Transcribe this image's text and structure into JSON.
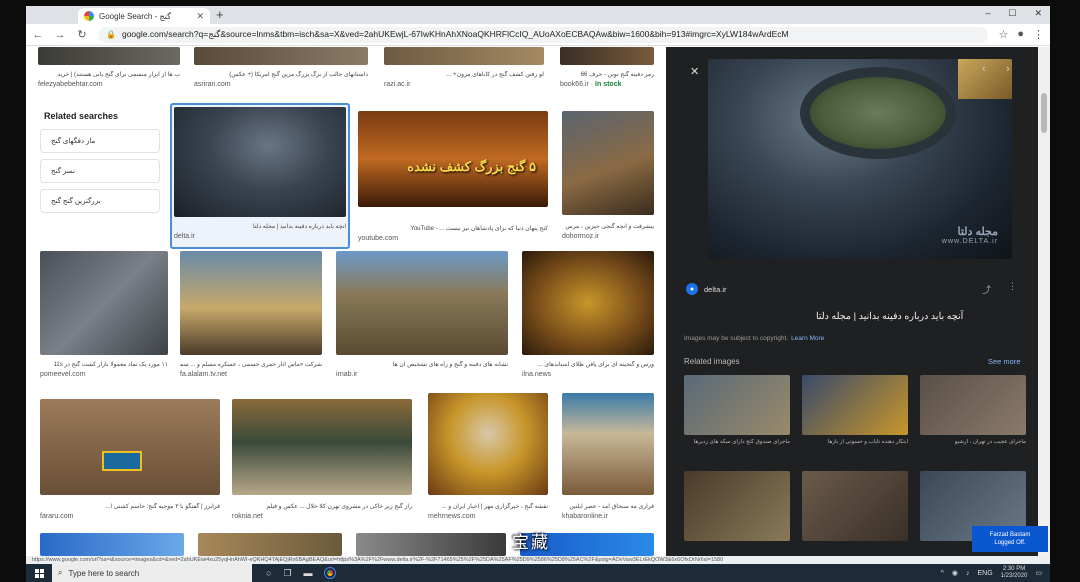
{
  "browser": {
    "tab_title": "Google Search - گنج",
    "new_tab": "+",
    "window_controls": [
      "–",
      "☐",
      "✕"
    ],
    "url": "google.com/search?q=گنج&source=lnms&tbm=isch&sa=X&ved=2ahUKEwjL-67IwKHnAhXNoaQKHRFlCcIQ_AUoAXoECBAQAw&biw=1600&bih=913#imgrc=XyLW184wArdEcM"
  },
  "top_row": [
    {
      "caption": "ب ها از ابزار منسمی برای گنج یابی هستند) | خرید",
      "site": "felezyabebehtar.com"
    },
    {
      "caption": "داستانهای جالب از برگ یزرگ مزین گنج آمریکا (+ عکس)",
      "site": "asriran.com"
    },
    {
      "caption": "لو رفتن کشف گنج در کاناهای مزون+ ...",
      "site": "razi.ac.ir"
    },
    {
      "caption": "رمز دفینه گنج نوین - حرف 66",
      "site": "book66.ir",
      "instock": "In stock"
    }
  ],
  "related_searches": {
    "title": "Related searches",
    "items": [
      "ماز دفگهای گنج",
      "نسر گنج",
      "بزرگترین گنج گنج"
    ]
  },
  "row2": [
    {
      "caption": "آنچه باید درباره دفینه بدانید | مجله دلتا",
      "site": "delta.ir"
    },
    {
      "caption": "کنج پنهان دنیا که برای پادشاهان نیز نیست ... - YouTube",
      "site": "youtube.com",
      "banner": "۵ گنج بزرگ کشف نشده"
    },
    {
      "caption": "پیشرفت و آنچه گنجی حیزین ، مرس",
      "site": "dohormoz.ir"
    }
  ],
  "row3": [
    {
      "caption": "۱۱ مورد یک نماد معمولا بازار کشت گنج در 11s",
      "site": "pomeevel.com"
    },
    {
      "caption": "شرکت «ماس آثار حمری جسمی ، عسكره مسلم و ... سمتان گنجشه",
      "site": "fa.alalam.tv.net"
    },
    {
      "caption": "نشانه های دفینه و گنج و راه های تشخیص آن ها",
      "site": "irnab.ir"
    },
    {
      "caption": "ورس و گنجینه ای برای پافن طلای استاندهای ...",
      "site": "ilna.news"
    }
  ],
  "row4": [
    {
      "caption": "فرابرز | گفتگو با ۳ موجبه گنج: حاسم کشتی آ...",
      "site": "fararu.com"
    },
    {
      "caption": "راز گنج زیر خاکی در مشروی تهرن کلا خلال ... عکس و فیلم",
      "site": "roknia.net"
    },
    {
      "caption": "نقشه گنج ، خبرگزاری مهر | اخبار ایران و ...",
      "site": "mehrnews.com"
    },
    {
      "caption": "قراری مه سنجاق آمد - عصر ایلتین",
      "site": "khabaronline.ir"
    }
  ],
  "preview": {
    "close": "✕",
    "watermark_fa": "مجله دلتا",
    "watermark_en": "www.DELTA.ir",
    "source": "delta.ir",
    "title": "آنچه باید درباره دفینه بدانید | مجله دلتا",
    "copyright": "Images may be subject to copyright.",
    "learn_more": "Learn More",
    "related_title": "Related images",
    "see_more": "See more",
    "related_captions": [
      "ماجرای صندوق گنج دارای سکه های زدیرها",
      "ابتکار دهنده تایاب و حسوتی از بازها",
      "ماجرای عجیب در تهران ، آرشیو",
      "",
      "",
      ""
    ]
  },
  "status_url": "https://www.google.com/url?sa=i&source=images&cd=&ved=2ahUKEwi4xu25yqHnAhWI-eQKHQ4TAjEQjRx6BAgBEAQ&url=https%3A%2F%2Fwww.delta.ir%2F-%2F71465%25%2F%25DA%25AF%25D9%2586%25D8%25AC%2F&psig=AOvVaw3ELrEkQOW3&6x6OfxOrNr6sl=1580",
  "taskbar": {
    "search_placeholder": "Type here to search",
    "lang": "ENG",
    "time": "2:30 PM",
    "date": "1/23/2020"
  },
  "notification": {
    "line1": "Farzad Bastam",
    "line2": "Logged Off."
  },
  "subtitle": "宝藏"
}
